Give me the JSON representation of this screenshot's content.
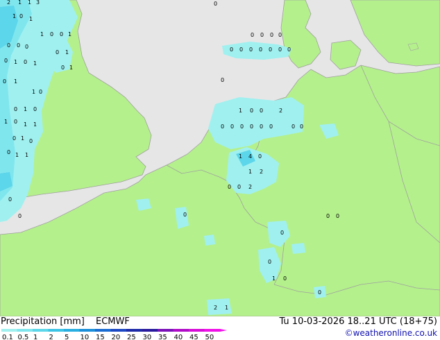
{
  "legend": {
    "title": "Precipitation [mm]",
    "model": "ECMWF",
    "valid": "Tu 10-03-2026 18..21 UTC (18+75)",
    "credit": "©weatheronline.co.uk",
    "ticks": [
      "0.1",
      "0.5",
      "1",
      "2",
      "5",
      "10",
      "15",
      "20",
      "25",
      "30",
      "35",
      "40",
      "45",
      "50"
    ],
    "colors": [
      "#a0f0f0",
      "#80e6ee",
      "#5cd6ea",
      "#3cc4e6",
      "#28aee0",
      "#1c8fda",
      "#1a6cd2",
      "#1c48c4",
      "#1e2aa8",
      "#2a1a9e",
      "#7a10b8",
      "#b00cc8",
      "#d80cd8",
      "#f010e8"
    ]
  },
  "map_colors": {
    "sea": "#e6e6e6",
    "land": "#b4f08c",
    "precip_light": "#a0f0f0",
    "precip_medium": "#5cd6ea",
    "border": "#a0a0a0"
  },
  "labels": {
    "north_sea": [
      "0",
      "0",
      "0",
      "0",
      "0",
      "0",
      "0",
      "0",
      "0",
      "0",
      "0",
      "0"
    ],
    "netherlands": [
      "1",
      "0",
      "0",
      "2",
      "0",
      "0",
      "0",
      "0",
      "0",
      "0",
      "0",
      "0"
    ],
    "belgium": [
      "1",
      "4",
      "0",
      "1",
      "2",
      "0",
      "0",
      "2"
    ],
    "britain": [
      "2",
      "1",
      "1",
      "3",
      "1",
      "0",
      "1",
      "1",
      "0",
      "0",
      "1",
      "0",
      "0",
      "0",
      "0",
      "1",
      "1",
      "0",
      "0",
      "1",
      "0",
      "1",
      "0",
      "1",
      "1",
      "0",
      "0",
      "1",
      "0",
      "1",
      "0",
      "1",
      "1",
      "0",
      "1",
      "0",
      "0",
      "1",
      "1"
    ],
    "france": [
      "0",
      "0",
      "0",
      "0",
      "0",
      "1",
      "0",
      "0",
      "2",
      "1"
    ],
    "germany": [
      "0",
      "0",
      "0"
    ]
  }
}
